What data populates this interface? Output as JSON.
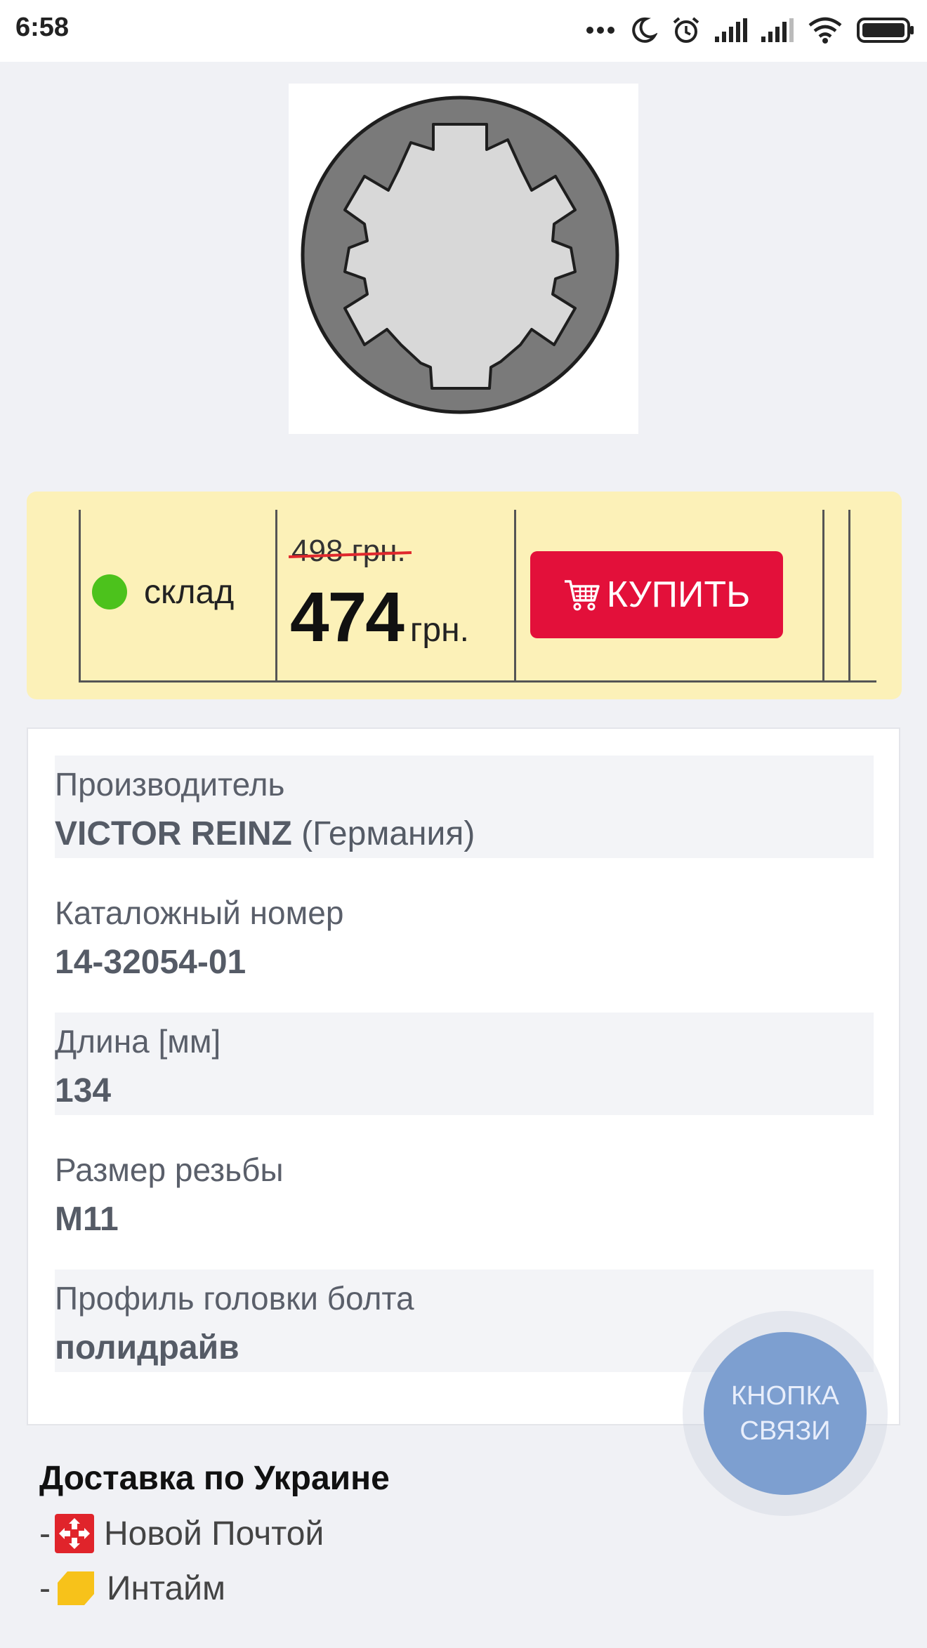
{
  "status_bar": {
    "time": "6:58",
    "icons": [
      "more-dots-icon",
      "moon-icon",
      "alarm-icon",
      "signal-1-icon",
      "signal-2-icon",
      "wifi-icon",
      "battery-icon"
    ]
  },
  "product": {
    "image_icon": "bolt-head-profile-icon"
  },
  "price_panel": {
    "stock_label": "склад",
    "stock_color": "#4cc21c",
    "old_price": "498 грн.",
    "new_price": "474",
    "currency": "грн.",
    "buy_button_label": "КУПИТЬ",
    "buy_button_color": "#e3103a"
  },
  "specs": [
    {
      "label": "Производитель",
      "value": "VICTOR REINZ",
      "note": "(Германия)"
    },
    {
      "label": "Каталожный номер",
      "value": "14-32054-01"
    },
    {
      "label": "Длина [мм]",
      "value": "134"
    },
    {
      "label": "Размер резьбы",
      "value": "M11"
    },
    {
      "label": "Профиль головки болта",
      "value": "полидрайв"
    }
  ],
  "delivery": {
    "title": "Доставка по Украине",
    "items": [
      {
        "dash": "-",
        "label": "Новой Почтой",
        "icon": "nova-poshta-logo-icon"
      },
      {
        "dash": "-",
        "label": "Интайм",
        "icon": "intime-logo-icon"
      }
    ]
  },
  "contact_button": {
    "line1": "КНОПКА",
    "line2": "СВЯЗИ"
  }
}
